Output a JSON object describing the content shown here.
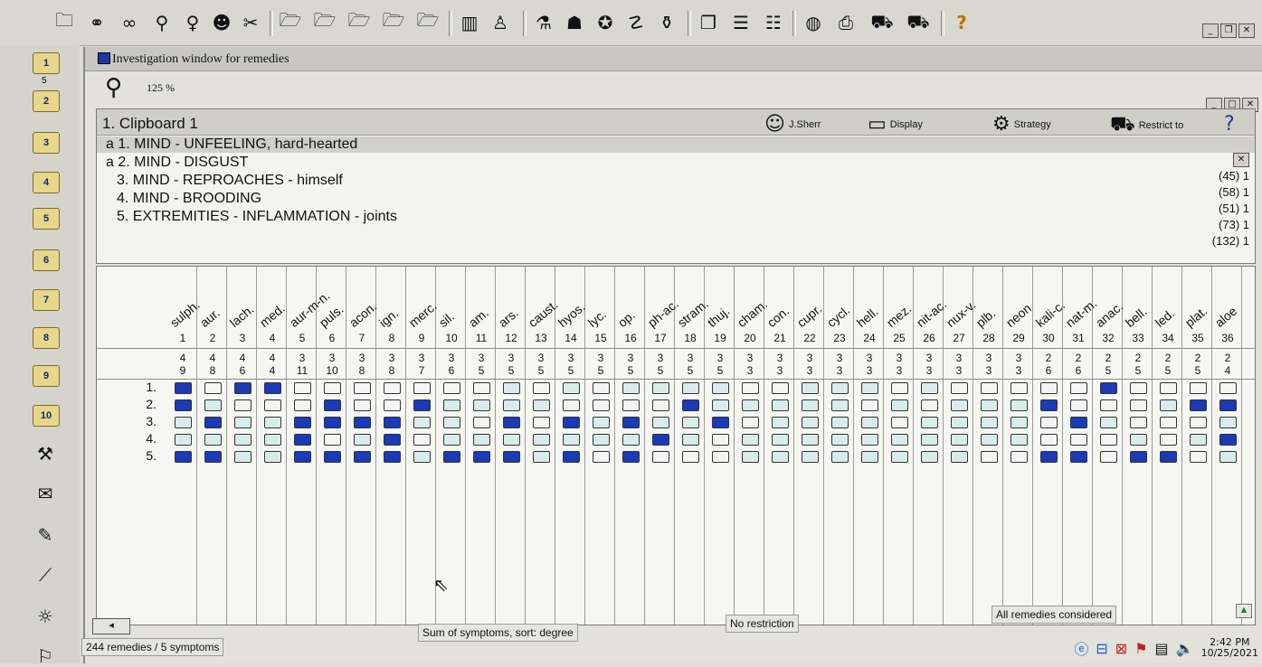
{
  "toolbar": {
    "icons": [
      "folder-open-icon",
      "binoculars-icon",
      "glasses-icon",
      "magnifier-icon",
      "lightbulb-icon",
      "head-icon",
      "scissors-icon",
      "folder-icon",
      "folder-1-icon",
      "folder-2-icon",
      "folder-3-icon",
      "folder-4-icon",
      "chart-icon",
      "family-icon",
      "flask-icon",
      "hat-icon",
      "lifebuoy-icon",
      "numbers-icon",
      "bottle-icon",
      "book-icon",
      "notes-icon",
      "list-icon",
      "globe-icon",
      "printer-icon",
      "car-icon",
      "car-2-icon",
      "help-icon"
    ]
  },
  "window": {
    "title": "Investigation window for remedies",
    "zoom": "125 %"
  },
  "sidebar": {
    "folders": [
      "1",
      "5",
      "2",
      "3",
      "4",
      "5",
      "6",
      "7",
      "8",
      "9",
      "10"
    ]
  },
  "clipboard": {
    "title": "1.  Clipboard 1",
    "user": "J.Sherr",
    "buttons": {
      "display": "Display",
      "strategy": "Strategy",
      "restrict": "Restrict to"
    },
    "symptoms": [
      {
        "label": "a 1. MIND - UNFEELING, hard-hearted",
        "count": ""
      },
      {
        "label": "a 2. MIND - DISGUST",
        "count": "(45) 1"
      },
      {
        "label": "3. MIND - REPROACHES - himself",
        "count": "(58) 1"
      },
      {
        "label": "4. MIND - BROODING",
        "count": "(51) 1"
      },
      {
        "label": "5. EXTREMITIES - INFLAMMATION - joints",
        "count": "(73) 1"
      }
    ],
    "extra_count": "(132) 1"
  },
  "grid": {
    "remedies": [
      "sulph.",
      "aur.",
      "lach.",
      "med.",
      "aur-m-n.",
      "puls.",
      "acon.",
      "ign.",
      "merc.",
      "sil.",
      "am.",
      "ars.",
      "caust.",
      "hyos.",
      "lyc.",
      "op.",
      "ph-ac.",
      "stram.",
      "thuj.",
      "cham.",
      "con.",
      "cupr.",
      "cycl.",
      "hell.",
      "mez.",
      "nit-ac.",
      "nux-v.",
      "plb.",
      "neon",
      "kali-c.",
      "nat-m.",
      "anac.",
      "bell.",
      "led.",
      "plat.",
      "aloe"
    ],
    "counts_a": [
      "4",
      "4",
      "4",
      "4",
      "3",
      "3",
      "3",
      "3",
      "3",
      "3",
      "3",
      "3",
      "3",
      "3",
      "3",
      "3",
      "3",
      "3",
      "3",
      "3",
      "3",
      "3",
      "3",
      "3",
      "3",
      "3",
      "3",
      "3",
      "3",
      "2",
      "2",
      "2",
      "2",
      "2",
      "2",
      "2"
    ],
    "counts_b": [
      "9",
      "8",
      "6",
      "4",
      "11",
      "10",
      "8",
      "8",
      "7",
      "6",
      "5",
      "5",
      "5",
      "5",
      "5",
      "5",
      "5",
      "5",
      "5",
      "3",
      "3",
      "3",
      "3",
      "3",
      "3",
      "3",
      "3",
      "3",
      "3",
      "6",
      "6",
      "5",
      "5",
      "5",
      "5",
      "4"
    ],
    "symptom_labels": [
      "1.",
      "2.",
      "3.",
      "4.",
      "5."
    ],
    "cells": [
      [
        3,
        0,
        3,
        3,
        0,
        0,
        0,
        0,
        0,
        0,
        0,
        1,
        0,
        1,
        0,
        1,
        1,
        1,
        1,
        0,
        0,
        1,
        1,
        1,
        0,
        1,
        0,
        0,
        0,
        0,
        0,
        3,
        0,
        0,
        0,
        0
      ],
      [
        3,
        1,
        0,
        0,
        0,
        3,
        0,
        0,
        3,
        1,
        1,
        1,
        1,
        0,
        0,
        0,
        0,
        3,
        1,
        1,
        1,
        1,
        1,
        0,
        1,
        0,
        1,
        1,
        1,
        3,
        0,
        0,
        0,
        1,
        3,
        3
      ],
      [
        1,
        3,
        1,
        1,
        3,
        3,
        3,
        3,
        1,
        1,
        0,
        3,
        0,
        3,
        1,
        3,
        1,
        1,
        3,
        0,
        1,
        1,
        1,
        1,
        0,
        1,
        1,
        1,
        1,
        0,
        3,
        1,
        0,
        0,
        0,
        1
      ],
      [
        1,
        1,
        1,
        1,
        3,
        0,
        1,
        3,
        0,
        1,
        1,
        1,
        1,
        1,
        1,
        1,
        3,
        1,
        0,
        1,
        1,
        1,
        1,
        1,
        1,
        1,
        1,
        1,
        1,
        0,
        0,
        0,
        1,
        0,
        1,
        3
      ],
      [
        3,
        3,
        1,
        1,
        3,
        3,
        3,
        3,
        1,
        3,
        3,
        3,
        1,
        3,
        0,
        3,
        0,
        0,
        0,
        1,
        1,
        1,
        1,
        1,
        1,
        1,
        1,
        0,
        0,
        3,
        3,
        0,
        3,
        3,
        0,
        1
      ]
    ]
  },
  "status": {
    "remedies": "244 remedies / 5 symptoms",
    "sort": "Sum of symptoms, sort: degree",
    "restriction": "No restriction",
    "considered": "All remedies considered"
  },
  "clock": {
    "time": "2:42 PM",
    "date": "10/25/2021"
  }
}
